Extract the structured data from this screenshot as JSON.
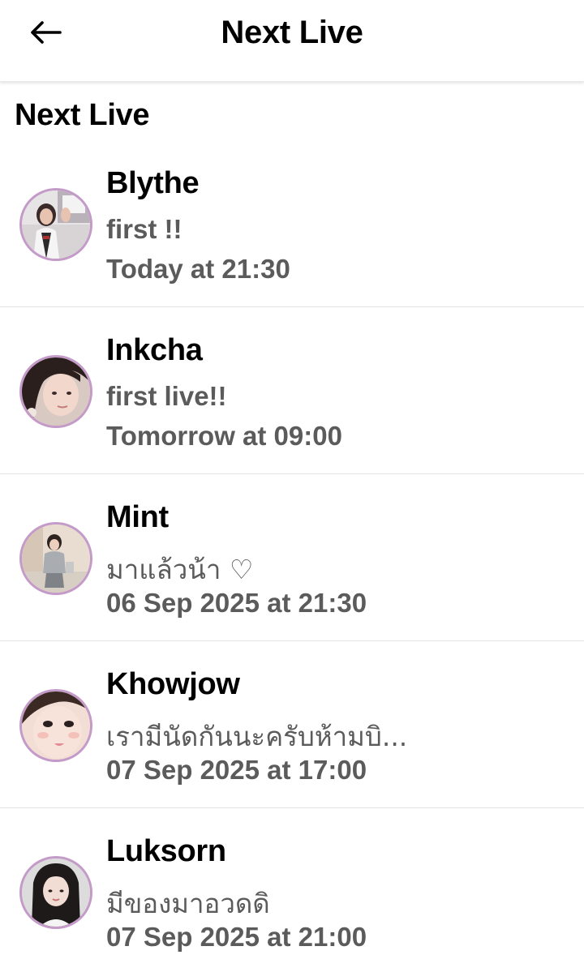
{
  "header": {
    "title": "Next Live",
    "back_icon": "arrow-left-icon"
  },
  "section": {
    "title": "Next Live"
  },
  "lives": [
    {
      "name": "Blythe",
      "message": "first !!",
      "schedule": "Today at 21:30"
    },
    {
      "name": "Inkcha",
      "message": "first live!!",
      "schedule": "Tomorrow at 09:00"
    },
    {
      "name": "Mint",
      "message": "มาแล้วน้า ♡",
      "schedule": "06 Sep 2025 at 21:30"
    },
    {
      "name": "Khowjow",
      "message": "เรามีนัดกันนะครับห้ามบิ...",
      "schedule": "07 Sep 2025 at 17:00"
    },
    {
      "name": "Luksorn",
      "message": "มีของมาอวดดิ",
      "schedule": "07 Sep 2025 at 21:00"
    }
  ],
  "colors": {
    "avatar_ring": "#c49ac8",
    "secondary_text": "#5b5b5b"
  }
}
